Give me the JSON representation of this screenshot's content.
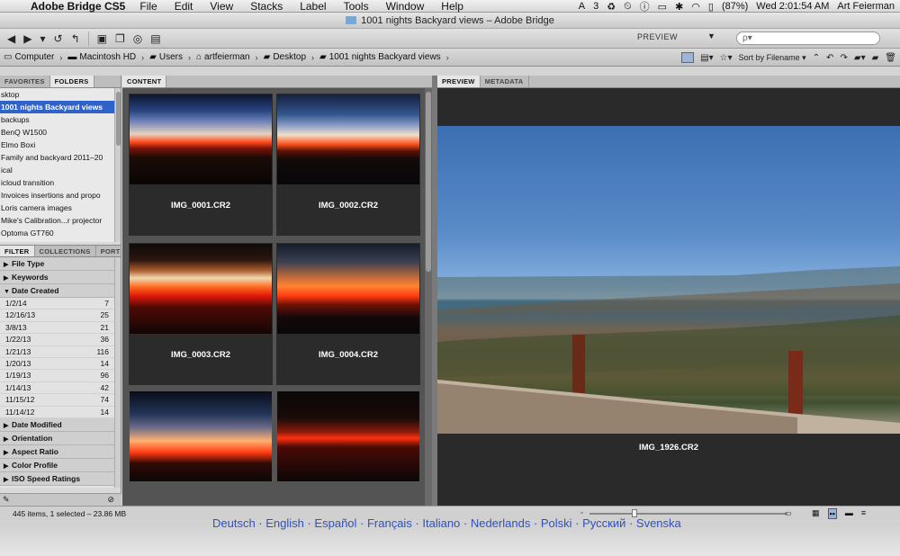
{
  "menubar": {
    "app_name": "Adobe Bridge CS5",
    "items": [
      "File",
      "Edit",
      "View",
      "Stacks",
      "Label",
      "Tools",
      "Window",
      "Help"
    ],
    "right": {
      "notification_count": "3",
      "battery": "(87%)",
      "clock": "Wed 2:01:54 AM",
      "user": "Art Feierman"
    }
  },
  "window": {
    "title": "1001 nights Backyard views – Adobe Bridge"
  },
  "toolbar": {
    "workspace_label": "PREVIEW",
    "search_placeholder": "ρ▾"
  },
  "path": {
    "crumbs": [
      "Computer",
      "Macintosh HD",
      "Users",
      "artfeierman",
      "Desktop",
      "1001 nights Backyard views"
    ],
    "sort_label": "Sort by Filename"
  },
  "left": {
    "tabs": [
      "FAVORITES",
      "FOLDERS"
    ],
    "folders": [
      "sktop",
      "1001 nights Backyard views",
      "backups",
      "BenQ W1500",
      "Elmo Boxi",
      "Family and backyard 2011–20",
      "ical",
      "icloud transition",
      "Invoices insertions and propo",
      "Loris camera images",
      "Mike's Calibration...r projector",
      "Optoma GT760"
    ],
    "selected_index": 1,
    "filter_tabs": [
      "FILTER",
      "COLLECTIONS",
      "PORT"
    ],
    "filter_heads_top": [
      "File Type",
      "Keywords",
      "Date Created"
    ],
    "dates": [
      {
        "date": "1/2/14",
        "count": "7"
      },
      {
        "date": "12/16/13",
        "count": "25"
      },
      {
        "date": "3/8/13",
        "count": "21"
      },
      {
        "date": "1/22/13",
        "count": "36"
      },
      {
        "date": "1/21/13",
        "count": "116"
      },
      {
        "date": "1/20/13",
        "count": "14"
      },
      {
        "date": "1/19/13",
        "count": "96"
      },
      {
        "date": "1/14/13",
        "count": "42"
      },
      {
        "date": "11/15/12",
        "count": "74"
      },
      {
        "date": "11/14/12",
        "count": "14"
      }
    ],
    "filter_heads_bottom": [
      "Date Modified",
      "Orientation",
      "Aspect Ratio",
      "Color Profile",
      "ISO Speed Ratings"
    ]
  },
  "content": {
    "tab": "CONTENT",
    "thumbnails": [
      {
        "name": "IMG_0001.CR2",
        "style": "sunset-a"
      },
      {
        "name": "IMG_0002.CR2",
        "style": "sunset-b"
      },
      {
        "name": "IMG_0003.CR2",
        "style": "sunset-c"
      },
      {
        "name": "IMG_0004.CR2",
        "style": "sunset-d"
      },
      {
        "name": "",
        "style": "sunset-e"
      },
      {
        "name": "",
        "style": "sunset-f"
      }
    ]
  },
  "preview": {
    "tabs": [
      "PREVIEW",
      "METADATA"
    ],
    "filename": "IMG_1926.CR2"
  },
  "status": {
    "text": "445 items, 1 selected – 23.86 MB",
    "zoom_fraction": 0.22
  },
  "below": {
    "languages": "Deutsch · English · Español · Français · Italiano · Nederlands · Polski · Русский · Svenska"
  },
  "colors": {
    "selection": "#2f63c9",
    "content_bg": "#545454"
  }
}
